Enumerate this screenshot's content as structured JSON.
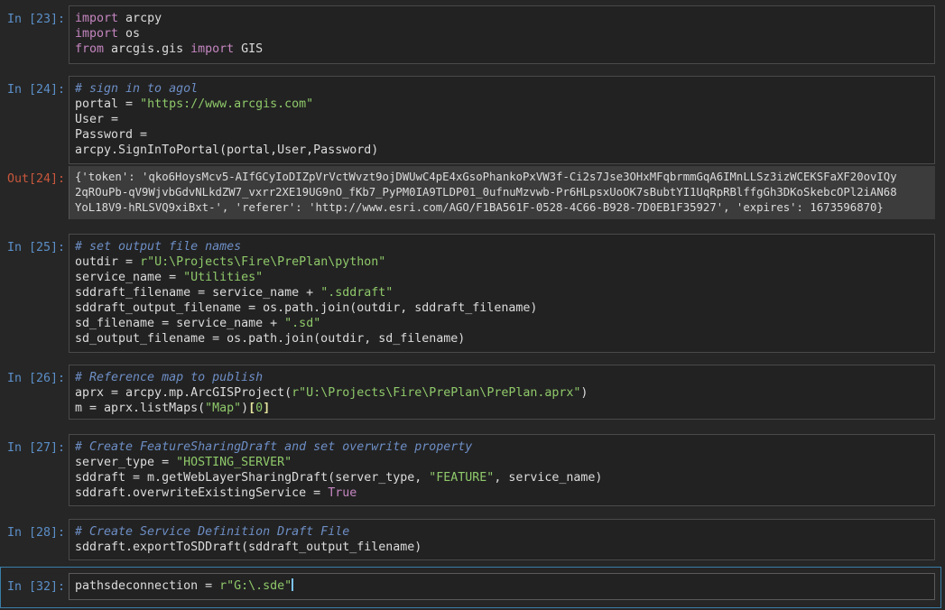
{
  "cells": [
    {
      "prompt": "In [23]:",
      "lines": [
        [
          [
            "kw",
            "import"
          ],
          [
            "op",
            " arcpy"
          ]
        ],
        [
          [
            "kw",
            "import"
          ],
          [
            "op",
            " os"
          ]
        ],
        [
          [
            "kw",
            "from"
          ],
          [
            "op",
            " arcgis.gis "
          ],
          [
            "kw",
            "import"
          ],
          [
            "op",
            " GIS"
          ]
        ]
      ]
    },
    {
      "prompt": "In [24]:",
      "lines": [
        [
          [
            "cm",
            "# sign in to agol"
          ]
        ],
        [
          [
            "op",
            "portal = "
          ],
          [
            "str",
            "\"https://www.arcgis.com\""
          ]
        ],
        [
          [
            "op",
            "User ="
          ]
        ],
        [
          [
            "op",
            "Password ="
          ]
        ],
        [
          [
            "op",
            "arcpy.SignInToPortal(portal,User,Password)"
          ]
        ]
      ]
    },
    {
      "prompt": "Out[24]:",
      "output": [
        "{'token': 'qko6HoysMcv5-AIfGCyIoDIZpVrVctWvzt9ojDWUwC4pE4xGsoPhankoPxVW3f-Ci2s7Jse3OHxMFqbrmmGqA6IMnLLSz3izWCEKSFaXF20ovIQy",
        "2qROuPb-qV9WjvbGdvNLkdZW7_vxrr2XE19UG9nO_fKb7_PyPM0IA9TLDP01_0ufnuMzvwb-Pr6HLpsxUoOK7sBubtYI1UqRpRBlffgGh3DKoSkebcOPl2iAN68",
        "YoL18V9-hRLSVQ9xiBxt-', 'referer': 'http://www.esri.com/AGO/F1BA561F-0528-4C66-B928-7D0EB1F35927', 'expires': 1673596870}"
      ]
    },
    {
      "prompt": "In [25]:",
      "lines": [
        [
          [
            "cm",
            "# set output file names"
          ]
        ],
        [
          [
            "op",
            "outdir = "
          ],
          [
            "str",
            "r\"U:\\Projects\\Fire\\PrePlan\\python\""
          ]
        ],
        [
          [
            "op",
            "service_name = "
          ],
          [
            "str",
            "\"Utilities\""
          ]
        ],
        [
          [
            "op",
            "sddraft_filename = service_name + "
          ],
          [
            "str",
            "\".sddraft\""
          ]
        ],
        [
          [
            "op",
            "sddraft_output_filename = os.path.join(outdir, sddraft_filename)"
          ]
        ],
        [
          [
            "op",
            "sd_filename = service_name + "
          ],
          [
            "str",
            "\".sd\""
          ]
        ],
        [
          [
            "op",
            "sd_output_filename = os.path.join(outdir, sd_filename)"
          ]
        ]
      ]
    },
    {
      "prompt": "In [26]:",
      "lines": [
        [
          [
            "cm",
            "# Reference map to publish"
          ]
        ],
        [
          [
            "op",
            "aprx = arcpy.mp.ArcGISProject("
          ],
          [
            "str",
            "r\"U:\\Projects\\Fire\\PrePlan\\PrePlan.aprx\""
          ],
          [
            "op",
            ")"
          ]
        ],
        [
          [
            "op",
            "m = aprx.listMaps("
          ],
          [
            "str",
            "\"Map\""
          ],
          [
            "op",
            ")"
          ],
          [
            "brk",
            "["
          ],
          [
            "str",
            "0"
          ],
          [
            "brk",
            "]"
          ]
        ]
      ]
    },
    {
      "prompt": "In [27]:",
      "lines": [
        [
          [
            "cm",
            "# Create FeatureSharingDraft and set overwrite property"
          ]
        ],
        [
          [
            "op",
            "server_type = "
          ],
          [
            "str",
            "\"HOSTING_SERVER\""
          ]
        ],
        [
          [
            "op",
            "sddraft = m.getWebLayerSharingDraft(server_type, "
          ],
          [
            "str",
            "\"FEATURE\""
          ],
          [
            "op",
            ", service_name)"
          ]
        ],
        [
          [
            "op",
            "sddraft.overwriteExistingService = "
          ],
          [
            "kw",
            "True"
          ]
        ]
      ]
    },
    {
      "prompt": "In [28]:",
      "lines": [
        [
          [
            "cm",
            "# Create Service Definition Draft File"
          ]
        ],
        [
          [
            "op",
            "sddraft.exportToSDDraft(sddraft_output_filename)"
          ]
        ]
      ]
    },
    {
      "prompt": "In [32]:",
      "lines": [
        [
          [
            "op",
            "pathsdeconnection = "
          ],
          [
            "str",
            "r\"G:\\.sde\""
          ]
        ]
      ]
    }
  ]
}
